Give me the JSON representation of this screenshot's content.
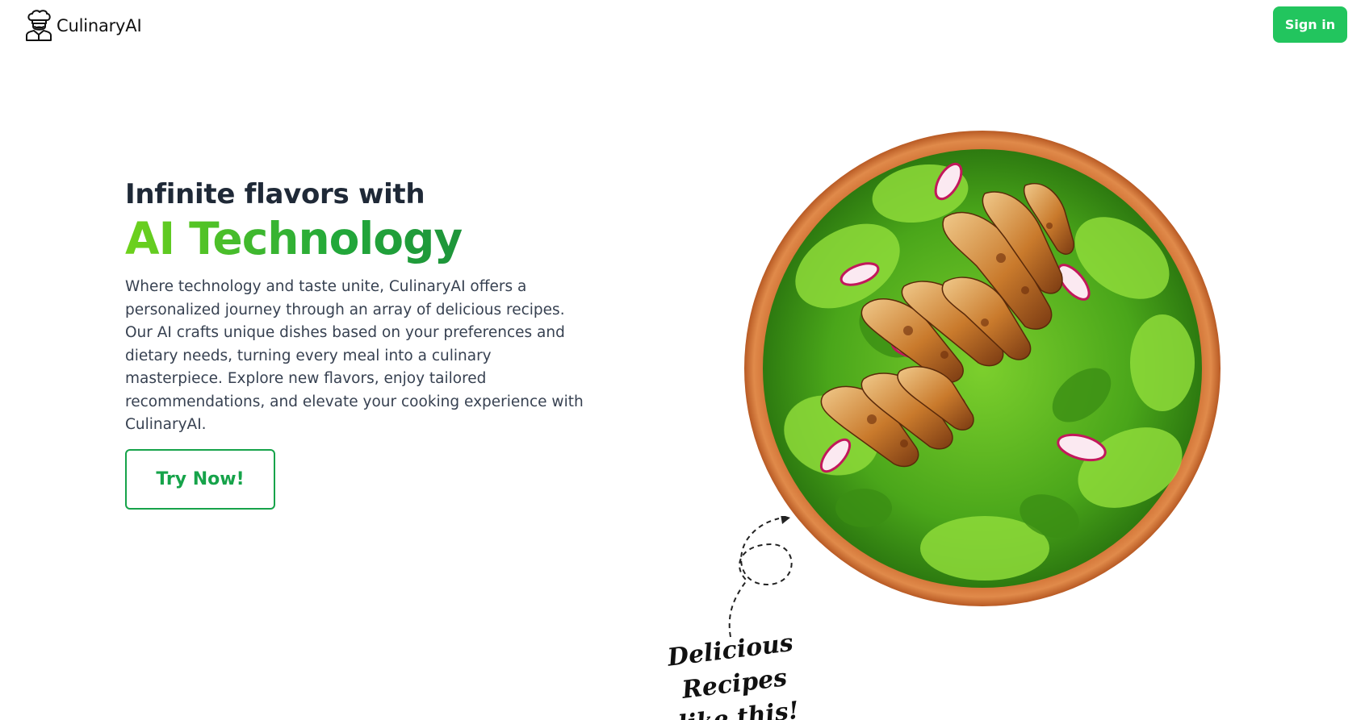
{
  "header": {
    "logo_text": "CulinaryAI",
    "logo_icon": "chef-icon",
    "signin_label": "Sign in"
  },
  "hero": {
    "title_line1": "Infinite flavors with",
    "title_line2": "AI Technology",
    "description": "Where technology and taste unite, CulinaryAI offers a personalized journey through an array of delicious recipes. Our AI crafts unique dishes based on your preferences and dietary needs, turning every meal into a culinary masterpiece. Explore new flavors, enjoy tailored recommendations, and elevate your cooking experience with CulinaryAI.",
    "cta_label": "Try Now!"
  },
  "showcase": {
    "image_subject": "salad-bowl-image",
    "annotation_line1": "Delicious Recipes",
    "annotation_line2": "like this!",
    "arrow_icon": "dashed-arrow-icon"
  },
  "colors": {
    "accent": "#22c55e",
    "cta_border": "#16a34a",
    "gradient_start": "#6ed21c",
    "gradient_end": "#1a7f3b",
    "bowl": "#d4783a"
  }
}
